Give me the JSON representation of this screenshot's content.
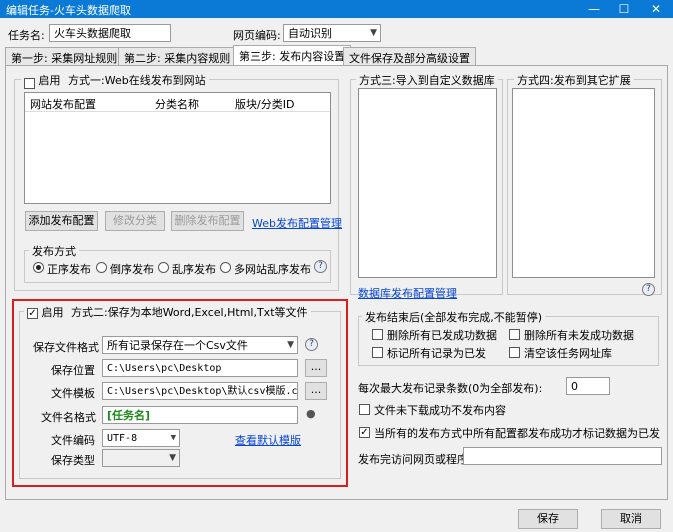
{
  "window": {
    "title": "编辑任务-火车头数据爬取",
    "controls": [
      "—",
      "☐",
      "✕"
    ]
  },
  "task": {
    "name_label": "任务名:",
    "name_value": "火车头数据爬取",
    "encoding_label": "网页编码:",
    "encoding_value": "自动识别"
  },
  "tabs": [
    "第一步: 采集网址规则",
    "第二步: 采集内容规则",
    "第三步: 发布内容设置",
    "文件保存及部分高级设置"
  ],
  "method1": {
    "enable_label": "启用",
    "title": "方式一:Web在线发布到网站",
    "columns": [
      "网站发布配置",
      "分类名称",
      "版块/分类ID"
    ],
    "buttons": {
      "add": "添加发布配置",
      "edit": "修改分类",
      "delete": "删除发布配置"
    },
    "manage_link": "Web发布配置管理",
    "publish_group": "发布方式",
    "modes": [
      "正序发布",
      "倒序发布",
      "乱序发布",
      "多网站乱序发布"
    ]
  },
  "method3": {
    "title": "方式三:导入到自定义数据库",
    "manage_link": "数据库发布配置管理"
  },
  "method4": {
    "title": "方式四:发布到其它扩展"
  },
  "method2": {
    "enable_label": "启用",
    "title": "方式二:保存为本地Word,Excel,Html,Txt等文件",
    "format_label": "保存文件格式",
    "format_value": "所有记录保存在一个Csv文件",
    "location_label": "保存位置",
    "location_value": "C:\\Users\\pc\\Desktop",
    "template_label": "文件模板",
    "template_value": "C:\\Users\\pc\\Desktop\\默认csv模版.csv",
    "filename_label": "文件名格式",
    "filename_value": "[任务名]",
    "encoding_label": "文件编码",
    "encoding_value": "UTF-8",
    "view_template_link": "查看默认模版",
    "savetype_label": "保存类型",
    "savetype_value": "",
    "dots": "..."
  },
  "after": {
    "group_title": "发布结束后(全部发布完成,不能暂停)",
    "delete_success": "删除所有已发成功数据",
    "delete_fail": "删除所有未发成功数据",
    "mark_all": "标记所有记录为已发",
    "clear_urls": "清空该任务网址库"
  },
  "max_label": "每次最大发布记录条数(0为全部发布):",
  "max_value": "0",
  "not_download": "文件未下载成功不发布内容",
  "mark_when_all": "当所有的发布方式中所有配置都发布成功才标记数据为已发",
  "visit_label": "发布完访问网页或程序",
  "visit_value": "",
  "footer": {
    "save": "保存",
    "cancel": "取消"
  },
  "icons": {
    "help": "help-icon",
    "insert": "tag-icon"
  }
}
